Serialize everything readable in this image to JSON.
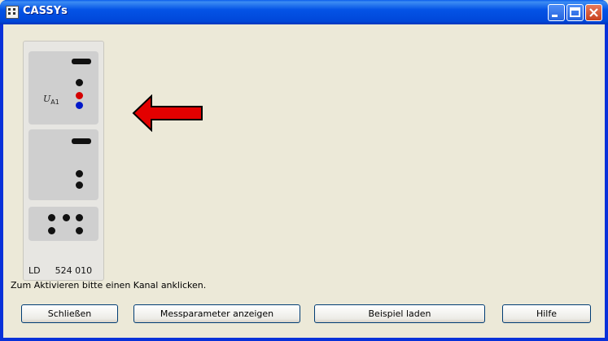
{
  "window": {
    "title": "CASSYs"
  },
  "device": {
    "channel_label": "U",
    "channel_sub": "A1",
    "maker": "LD",
    "model_number": "524 010"
  },
  "hint": "Zum Aktivieren bitte einen Kanal anklicken.",
  "buttons": {
    "close": "Schließen",
    "params": "Messparameter anzeigen",
    "example": "Beispiel laden",
    "help": "Hilfe"
  },
  "colors": {
    "titlebar": "#0453e6",
    "client_bg": "#ece9d8",
    "arrow": "#e30000",
    "red_socket": "#d40000",
    "blue_socket": "#0018c9"
  }
}
